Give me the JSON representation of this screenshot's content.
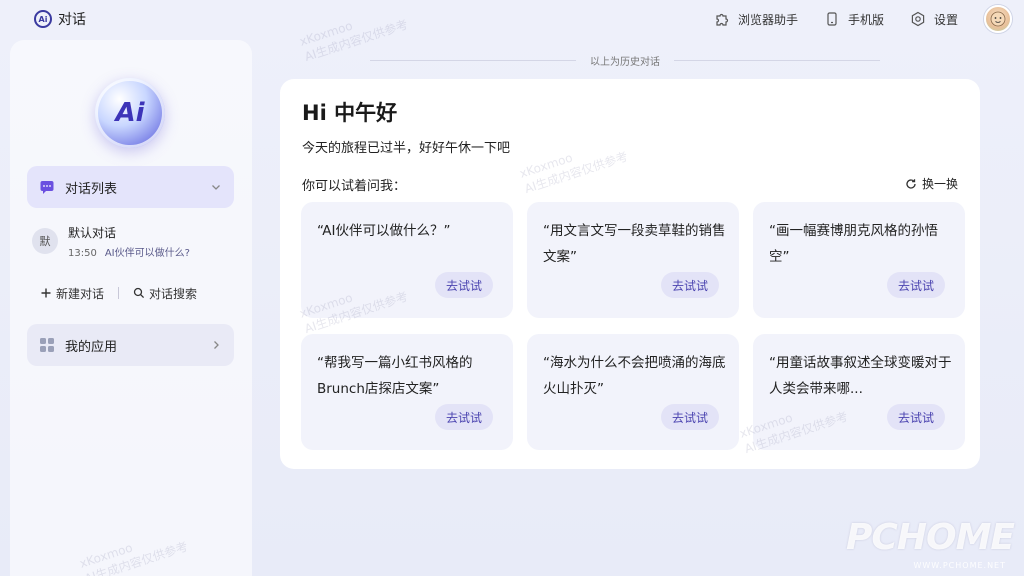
{
  "app": {
    "title": "对话",
    "logo_text": "Ai"
  },
  "topbar": {
    "browser_helper": "浏览器助手",
    "mobile": "手机版",
    "settings": "设置"
  },
  "sidebar": {
    "logo_text": "Ai",
    "conversation_list_label": "对话列表",
    "conversation": {
      "avatar_text": "默",
      "title": "默认对话",
      "time": "13:50",
      "preview": "AI伙伴可以做什么?"
    },
    "new_conversation": "新建对话",
    "search_conversation": "对话搜索",
    "my_apps": "我的应用"
  },
  "main": {
    "history_divider": "以上为历史对话",
    "greeting": "Hi 中午好",
    "subtitle": "今天的旅程已过半，好好午休一下吧",
    "try_label": "你可以试着问我：",
    "refresh_label": "换一换",
    "suggestions": [
      {
        "text": "“AI伙伴可以做什么？”",
        "button": "去试试"
      },
      {
        "text": "“用文言文写一段卖草鞋的销售文案”",
        "button": "去试试"
      },
      {
        "text": "“画一幅赛博朋克风格的孙悟空”",
        "button": "去试试"
      },
      {
        "text": "“帮我写一篇小红书风格的Brunch店探店文案”",
        "button": "去试试"
      },
      {
        "text": "“海水为什么不会把喷涌的海底火山扑灭”",
        "button": "去试试"
      },
      {
        "text": "“用童话故事叙述全球变暖对于人类会带来哪...",
        "button": "去试试"
      }
    ]
  },
  "watermark": {
    "line1": "xKoxmoo",
    "line2": "AI生成内容仅供参考",
    "brand": "PCHOME",
    "brand_sub": "WWW.PCHOME.NET"
  },
  "colors": {
    "accent": "#4b44b0",
    "card_bg": "#f2f3fb",
    "active_bg": "#e4e4fb"
  }
}
